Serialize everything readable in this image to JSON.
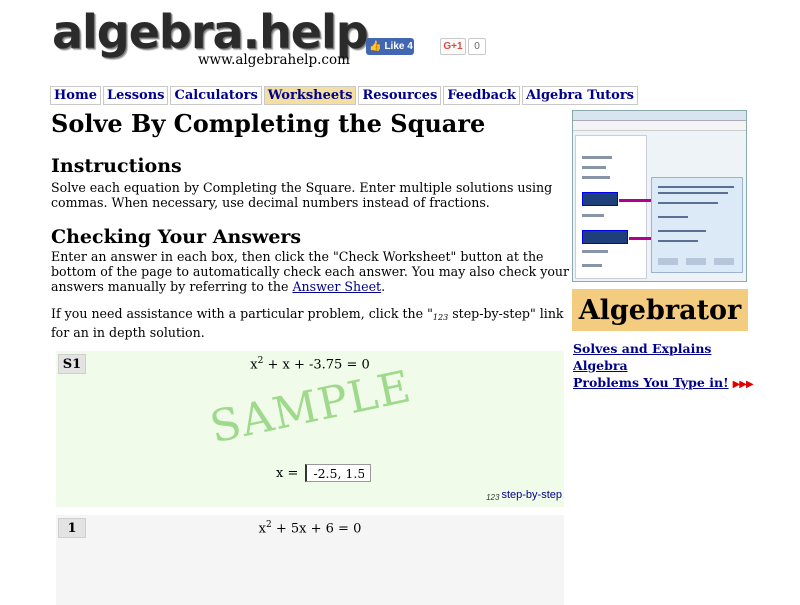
{
  "header": {
    "logo": "algebra.help",
    "site_url": "www.algebrahelp.com",
    "fb_like": "Like 4",
    "gplus": "G+1",
    "gplus_count": "0"
  },
  "nav": {
    "items": [
      "Home",
      "Lessons",
      "Calculators",
      "Worksheets",
      "Resources",
      "Feedback",
      "Algebra Tutors"
    ],
    "active": "Worksheets"
  },
  "page": {
    "title": "Solve By Completing the Square",
    "instructions_heading": "Instructions",
    "instructions_text": "Solve each equation by Completing the Square. Enter multiple solutions using commas. When necessary, use decimal numbers instead of fractions.",
    "checking_heading": "Checking Your Answers",
    "checking_text_1": "Enter an answer in each box, then click the \"Check Worksheet\" button at the bottom of the page to automatically check each answer.  You may also check your answers manually by referring to the ",
    "answer_sheet_link": "Answer Sheet",
    "checking_text_2": ".",
    "assist_text_1": " If you need assistance with a particular problem, click the \"",
    "assist_icon": "123",
    "assist_text_2": " step-by-step\" link for an in depth solution."
  },
  "sidebar": {
    "algebrator": "Algebrator",
    "promo_line1": "Solves and Explains Algebra",
    "promo_line2": "Problems You Type in!",
    "promo_arrows": "▶▶▶"
  },
  "problems": [
    {
      "label": "S1",
      "eq_before": "x",
      "eq_exp": "2",
      "eq_after": " + x + -3.75 = 0",
      "watermark": "SAMPLE",
      "answer_label": "x =",
      "answer_value": "-2.5, 1.5",
      "step_icon": "123",
      "step_link": "step-by-step"
    },
    {
      "label": "1",
      "eq_before": "x",
      "eq_exp": "2",
      "eq_after": " + 5x + 6 = 0"
    }
  ],
  "colors": {
    "nav_active_bg": "#f3dfa1",
    "link": "#00008b",
    "algebrator_bg": "#f3cc7f",
    "sample_bg": "#f0fbea",
    "watermark": "#9fd98c"
  }
}
